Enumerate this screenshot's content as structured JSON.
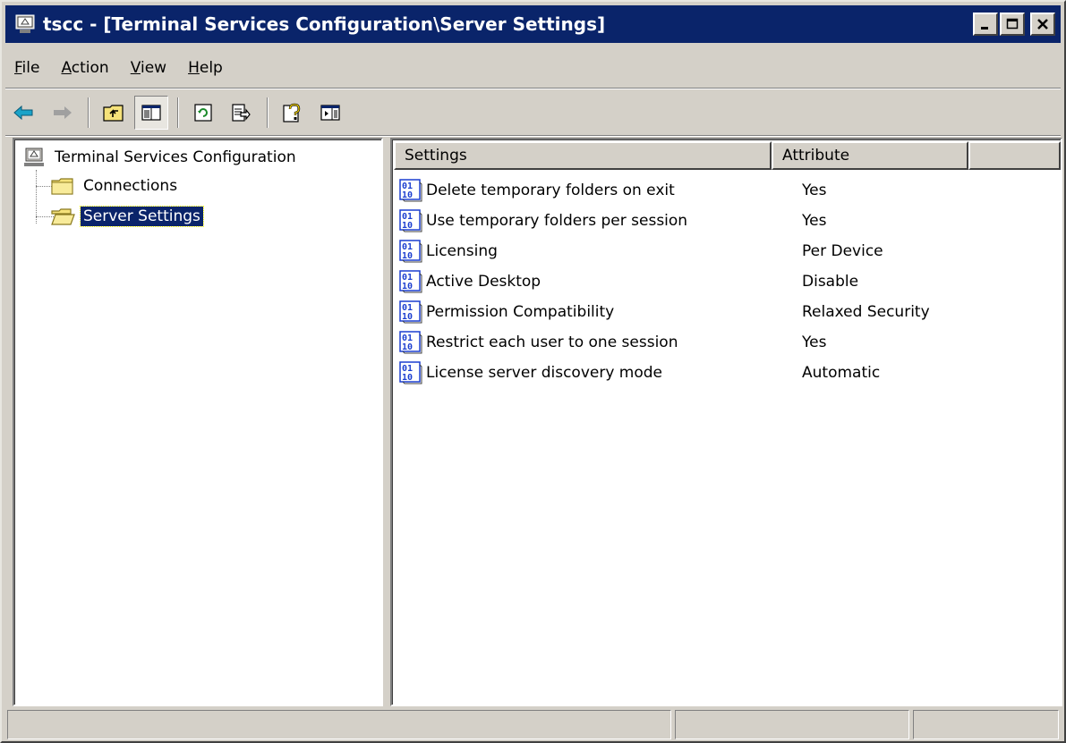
{
  "window": {
    "title": "tscc - [Terminal Services Configuration\\Server Settings]",
    "buttons": [
      "minimize",
      "maximize",
      "close"
    ]
  },
  "menu": [
    "File",
    "Action",
    "View",
    "Help"
  ],
  "toolbar": {
    "icons": [
      "back-arrow-icon",
      "forward-arrow-icon",
      "up-folder-icon",
      "show-hide-tree-icon",
      "refresh-icon",
      "export-list-icon",
      "help-icon",
      "action-pane-icon"
    ]
  },
  "tree": {
    "root": "Terminal Services Configuration",
    "children": [
      {
        "label": "Connections",
        "selected": false
      },
      {
        "label": "Server Settings",
        "selected": true
      }
    ]
  },
  "list": {
    "columns": [
      "Settings",
      "Attribute"
    ],
    "rows": [
      {
        "setting": "Delete temporary folders on exit",
        "attribute": "Yes"
      },
      {
        "setting": "Use temporary folders per session",
        "attribute": "Yes"
      },
      {
        "setting": "Licensing",
        "attribute": "Per Device"
      },
      {
        "setting": "Active Desktop",
        "attribute": "Disable"
      },
      {
        "setting": "Permission Compatibility",
        "attribute": "Relaxed Security"
      },
      {
        "setting": "Restrict each user to one session",
        "attribute": "Yes"
      },
      {
        "setting": "License server discovery mode",
        "attribute": "Automatic"
      }
    ]
  },
  "colors": {
    "titlebar": "#0a246a",
    "face": "#d4d0c8",
    "selection": "#0a246a",
    "icon_blue": "#1c3fd0"
  }
}
